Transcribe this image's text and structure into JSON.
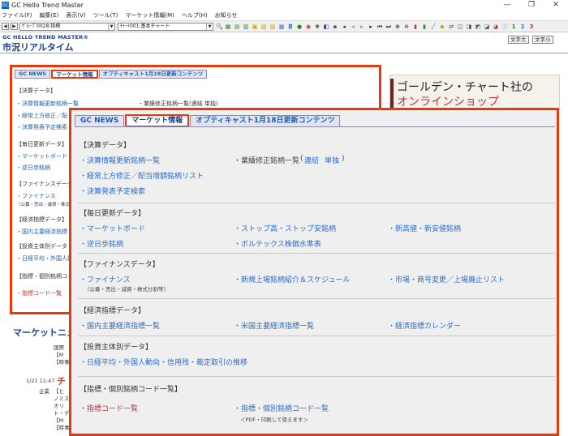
{
  "window": {
    "title": "GC Hello Trend Master",
    "controls": [
      "—",
      "❐",
      "✕"
    ]
  },
  "menu": [
    "ファイル(F)",
    "編集(E)",
    "表示(V)",
    "ツール(T)",
    "マーケット情報(M)",
    "ヘルプ(H)",
    "お知らせ"
  ],
  "toolbar": {
    "group_select": "ｸﾞﾙｰﾌﾟ0028:指標",
    "chart_select": "ﾁｬｰﾄ001:基本チャート"
  },
  "header": {
    "brand_top": "GC HELLO TREND MASTER®",
    "brand_main": "市況リアルタイム",
    "font_large": "文字大",
    "font_small": "文字小"
  },
  "tabs": [
    "GC NEWS",
    "マーケット情報",
    "オプティキャスト1月18日更新コンテンツ"
  ],
  "ad": {
    "line1": "ゴールデン・チャート社の",
    "line2": "オンラインショップ"
  },
  "background": {
    "lines": [
      "【決算データ】",
      "・決算情報更新銘柄一覧",
      "・業績修正銘柄一覧(連結 単独)",
      "・経常上方修正／配",
      "・決算発表予定検索",
      "【毎日更新データ】",
      "・マーケットボード",
      "・逆日歩銘柄",
      "【ファイナンスデータ",
      "・ファイナンス",
      "（公募・売出・減資・株式分",
      "【経済指標データ】",
      "・国内主要経済指標",
      "【投資主体別データ",
      "・日経平均・外国人動",
      "【指標・個別銘柄コー",
      "・指標コード一覧"
    ],
    "news_title": "マーケットニュ",
    "news_lines": [
      "国際",
      "【M",
      "【時事",
      "1/21 11:47",
      "企業",
      "【ヒ",
      "ノミス",
      "オリ",
      "ト・デ",
      "【M",
      "【時事"
    ],
    "news_red": "チ"
  },
  "sections": [
    {
      "title": "【決算データ】",
      "links": [
        "・決算情報更新銘柄一覧",
        "・業績修正銘柄一覧",
        "連結",
        "単独",
        "・経常上方修正／配当増額銘柄リスト",
        "・決算発表予定検索"
      ]
    },
    {
      "title": "【毎日更新データ】",
      "links": [
        "・マーケットボード",
        "・ストップ高・ストップ安銘柄",
        "・新高値・新安値銘柄",
        "・逆日歩銘柄",
        "・ボルテックス株価水準表"
      ]
    },
    {
      "title": "【ファイナンスデータ】",
      "links": [
        "・ファイナンス",
        "・新規上場銘柄紹介＆スケジュール",
        "・市場・商号変更／上場廃止リスト"
      ],
      "note": "（公募・売出・減資・株式分割等）"
    },
    {
      "title": "【経済指標データ】",
      "links": [
        "・国内主要経済指標一覧",
        "・米国主要経済指標一覧",
        "・経済指標カレンダー"
      ]
    },
    {
      "title": "【投資主体別データ】",
      "links": [
        "・日経平均・外国人動向・信用残・裁定取引の推移"
      ]
    },
    {
      "title": "【指標・個別銘柄コード一覧】",
      "links": [
        "・指標コード一覧",
        "・指標・個別銘柄コード一覧"
      ],
      "note": "＜PDF・印刷して使えます＞"
    }
  ],
  "colors": {
    "highlight": "#e8380c",
    "link": "#2a6ccc",
    "brand": "#1b3f8f"
  }
}
